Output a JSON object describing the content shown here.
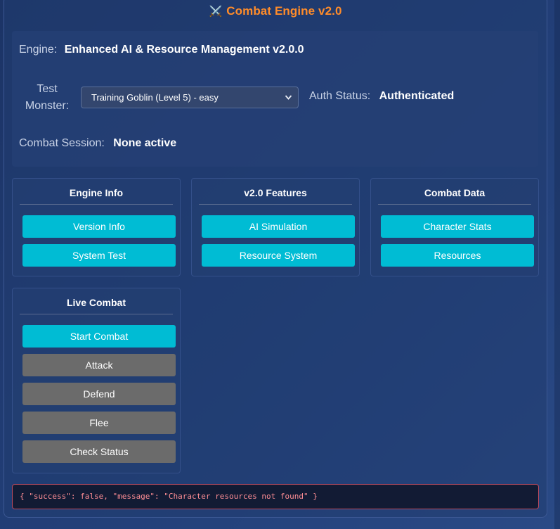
{
  "header": {
    "icon": "crossed-swords-icon",
    "title": "Combat Engine v2.0",
    "title_color": "#ff8c2a"
  },
  "info": {
    "engine_label": "Engine:",
    "engine_value": "Enhanced AI & Resource Management v2.0.0",
    "test_monster_label": "Test Monster:",
    "test_monster_selected": "Training Goblin (Level 5) - easy",
    "auth_label": "Auth Status:",
    "auth_value": "Authenticated",
    "session_label": "Combat Session:",
    "session_value": "None active"
  },
  "cards": {
    "engine_info": {
      "title": "Engine Info",
      "buttons": [
        "Version Info",
        "System Test"
      ]
    },
    "v2_features": {
      "title": "v2.0 Features",
      "buttons": [
        "AI Simulation",
        "Resource System"
      ]
    },
    "combat_data": {
      "title": "Combat Data",
      "buttons": [
        "Character Stats",
        "Resources"
      ]
    },
    "live_combat": {
      "title": "Live Combat",
      "buttons": [
        "Start Combat",
        "Attack",
        "Defend",
        "Flee",
        "Check Status"
      ]
    }
  },
  "colors": {
    "primary_button": "#00bcd4",
    "disabled_button": "#6b6b6b",
    "error_text": "#ff8e95",
    "error_border": "#b84a5e"
  },
  "result": {
    "text": "{ \"success\": false, \"message\": \"Character resources not found\" }"
  }
}
